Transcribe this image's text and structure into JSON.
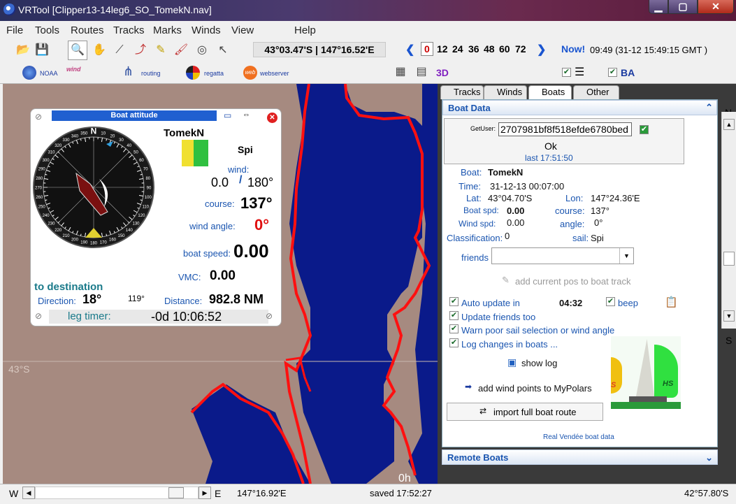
{
  "window": {
    "title": "VRTool [Clipper13-14leg6_SO_TomekN.nav]",
    "min": "▁",
    "max": "▢",
    "close": "✕"
  },
  "menu": [
    "File",
    "Tools",
    "Routes",
    "Tracks",
    "Marks",
    "Winds",
    "View",
    "Help"
  ],
  "toolbar": {
    "coords": "43°03.47'S | 147°16.52'E",
    "hours": [
      "0",
      "12",
      "24",
      "36",
      "48",
      "60",
      "72"
    ],
    "now": "Now!",
    "time": "09:49 (31-12 15:49:15 GMT )",
    "noaa": "NOAA",
    "wind": "wind",
    "routing": "routing",
    "regatta": "regatta",
    "webserver": "webserver",
    "threed": "3D",
    "ba": "BA"
  },
  "map": {
    "lat_label": "43°S",
    "time_label": "0h"
  },
  "attitude": {
    "title": "Boat attitude",
    "boat": "TomekN",
    "sail": "Spi",
    "wind_label": "wind:",
    "wind_speed": "0.0",
    "wind_sep": "/",
    "wind_dir": "180°",
    "course_label": "course:",
    "course": "137°",
    "wind_angle_label": "wind angle:",
    "wind_angle": "0°",
    "boat_speed_label": "boat speed:",
    "boat_speed": "0.00",
    "vmc_label": "VMC:",
    "vmc": "0.00",
    "to_dest": "to destination",
    "direction_label": "Direction:",
    "direction": "18°",
    "direction2": "119°",
    "distance_label": "Distance:",
    "distance": "982.8 NM",
    "leg_timer_label": "leg timer:",
    "leg_timer": "-0d 10:06:52",
    "compass": [
      "N",
      "10",
      "20",
      "30",
      "40",
      "50",
      "60",
      "70",
      "80",
      "90",
      "100",
      "110",
      "120",
      "130",
      "140",
      "150",
      "160",
      "170",
      "180",
      "190",
      "200",
      "210",
      "220",
      "230",
      "240",
      "250",
      "260",
      "270",
      "280",
      "290",
      "300",
      "310",
      "320",
      "330",
      "340",
      "350"
    ]
  },
  "tabs": [
    "Tracks",
    "Winds",
    "Boats",
    "Other"
  ],
  "boat_data": {
    "header": "Boat Data",
    "getuser_label": "GetUser:",
    "getuser_value": "2707981bf8f518efde6780bed",
    "ok": "Ok",
    "last": "last 17:51:50",
    "boat_label": "Boat:",
    "boat": "TomekN",
    "time_label": "Time:",
    "time": "31-12-13 00:07:00",
    "lat_label": "Lat:",
    "lat": "43°04.70'S",
    "lon_label": "Lon:",
    "lon": "147°24.36'E",
    "boatspd_label": "Boat spd:",
    "boatspd": "0.00",
    "course_label": "course:",
    "course": "137°",
    "windspd_label": "Wind spd:",
    "windspd": "0.00",
    "angle_label": "angle:",
    "angle": "0°",
    "class_label": "Classification:",
    "class": "0",
    "sail_label": "sail:",
    "sail": "Spi",
    "friends_label": "friends",
    "add_pos": "add current pos to boat track",
    "auto_update": "Auto update in",
    "auto_time": "04:32",
    "beep": "beep",
    "update_friends": "Update friends too",
    "warn": "Warn poor sail selection or wind angle",
    "log_changes": "Log changes in boats ...",
    "show_log": "show log",
    "add_wind": "add wind points to MyPolars",
    "import": "import full boat route",
    "real_vendee": "Real Vendée boat data",
    "sail_labels": [
      "S",
      "HS"
    ]
  },
  "remote_boats": "Remote Boats",
  "side": {
    "n": "N",
    "s": "S"
  },
  "status": {
    "w": "W",
    "e": "E",
    "lon": "147°16.92'E",
    "saved": "saved 17:52:27",
    "lat": "42°57.80'S"
  }
}
